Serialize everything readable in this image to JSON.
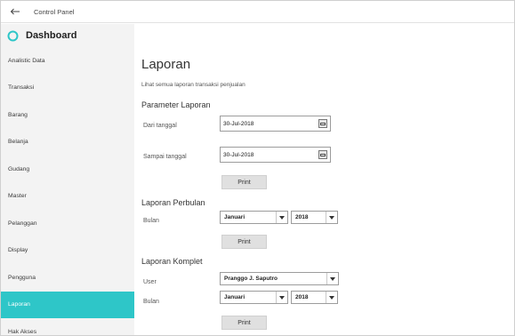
{
  "window": {
    "title": "Control Panel"
  },
  "sidebar": {
    "header": "Dashboard",
    "items": [
      {
        "label": "Analistic Data"
      },
      {
        "label": "Transaksi"
      },
      {
        "label": "Barang"
      },
      {
        "label": "Belanja"
      },
      {
        "label": "Gudang"
      },
      {
        "label": "Master"
      },
      {
        "label": "Pelanggan"
      },
      {
        "label": "Display"
      },
      {
        "label": "Pengguna"
      },
      {
        "label": "Laporan",
        "active": true
      },
      {
        "label": "Hak Akses"
      }
    ]
  },
  "main": {
    "title": "Laporan",
    "subtitle": "Lihat semua laporan transaksi penjualan",
    "parameter": {
      "title": "Parameter Laporan",
      "from_label": "Dari tanggal",
      "from_value": "30-Jul-2018",
      "to_label": "Sampai tanggal",
      "to_value": "30-Jul-2018",
      "print_label": "Print"
    },
    "monthly": {
      "title": "Laporan Perbulan",
      "month_label": "Bulan",
      "month_value": "Januari",
      "year_value": "2018",
      "print_label": "Print"
    },
    "complete": {
      "title": "Laporan Komplet",
      "user_label": "User",
      "user_value": "Pranggo J. Saputro",
      "month_label": "Bulan",
      "month_value": "Januari",
      "year_value": "2018",
      "print_label": "Print"
    }
  },
  "colors": {
    "accent": "#2ec6c8",
    "sidebar_bg": "#f3f3f3",
    "button_bg": "#e0e0e0"
  },
  "icons": {
    "back": "arrow-left-icon",
    "dashboard": "circle-icon",
    "calendar": "calendar-icon",
    "dropdown": "chevron-down-icon"
  }
}
